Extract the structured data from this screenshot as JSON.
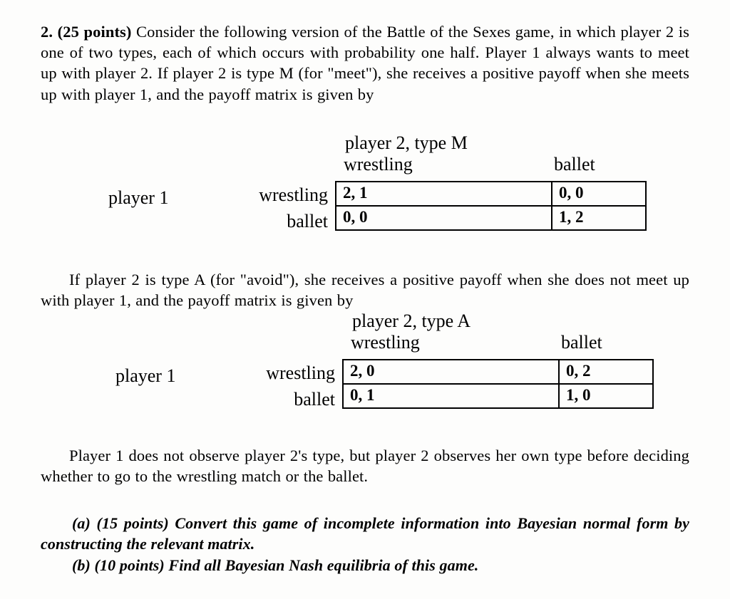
{
  "document": {
    "type": "problem-set-question",
    "question_number": "2.",
    "points": "(25 points)"
  },
  "intro": {
    "lead": "2.  (25 points)",
    "text": " Consider the following version of the Battle of the Sexes game, in which player 2 is one of two types, each of which occurs with probability one half.  Player 1 always wants to meet up with player 2.  If player 2 is type M (for \"meet\"), she receives a positive payoff when she meets up with player 1, and the payoff matrix is given by"
  },
  "matrix_M": {
    "column_group_title": "player 2, type M",
    "player_label": "player 1",
    "col_headers": [
      "wrestling",
      "ballet"
    ],
    "row_headers": [
      "wrestling",
      "ballet"
    ],
    "cells": [
      [
        "2, 1",
        "0, 0"
      ],
      [
        "0, 0",
        "1, 2"
      ]
    ]
  },
  "typeA_para": {
    "text": "If player 2 is type A (for \"avoid\"), she receives a positive payoff when she does not meet up with player 1, and the payoff matrix is given by"
  },
  "matrix_A": {
    "column_group_title": "player 2, type A",
    "player_label": "player 1",
    "col_headers": [
      "wrestling",
      "ballet"
    ],
    "row_headers": [
      "wrestling",
      "ballet"
    ],
    "cells": [
      [
        "2, 0",
        "0, 2"
      ],
      [
        "0, 1",
        "1, 0"
      ]
    ]
  },
  "observe_para": {
    "text": "Player 1 does not observe player 2's type, but player 2 observes her own type before deciding whether to go to the wrestling match or the ballet."
  },
  "parts": {
    "a": "(a) (15 points) Convert this game of incomplete information into Bayesian normal form by constructing the relevant matrix.",
    "b": "(b) (10 points) Find all Bayesian Nash equilibria of this game."
  },
  "chart_data": {
    "type": "table",
    "title": "Battle of the Sexes with incomplete information",
    "tables": [
      {
        "name": "player 2, type M",
        "row_player": "player 1",
        "columns": [
          "wrestling",
          "ballet"
        ],
        "rows": [
          "wrestling",
          "ballet"
        ],
        "payoffs": [
          [
            [
              2,
              1
            ],
            [
              0,
              0
            ]
          ],
          [
            [
              0,
              0
            ],
            [
              1,
              2
            ]
          ]
        ]
      },
      {
        "name": "player 2, type A",
        "row_player": "player 1",
        "columns": [
          "wrestling",
          "ballet"
        ],
        "rows": [
          "wrestling",
          "ballet"
        ],
        "payoffs": [
          [
            [
              2,
              0
            ],
            [
              0,
              2
            ]
          ],
          [
            [
              0,
              1
            ],
            [
              1,
              0
            ]
          ]
        ]
      }
    ]
  }
}
